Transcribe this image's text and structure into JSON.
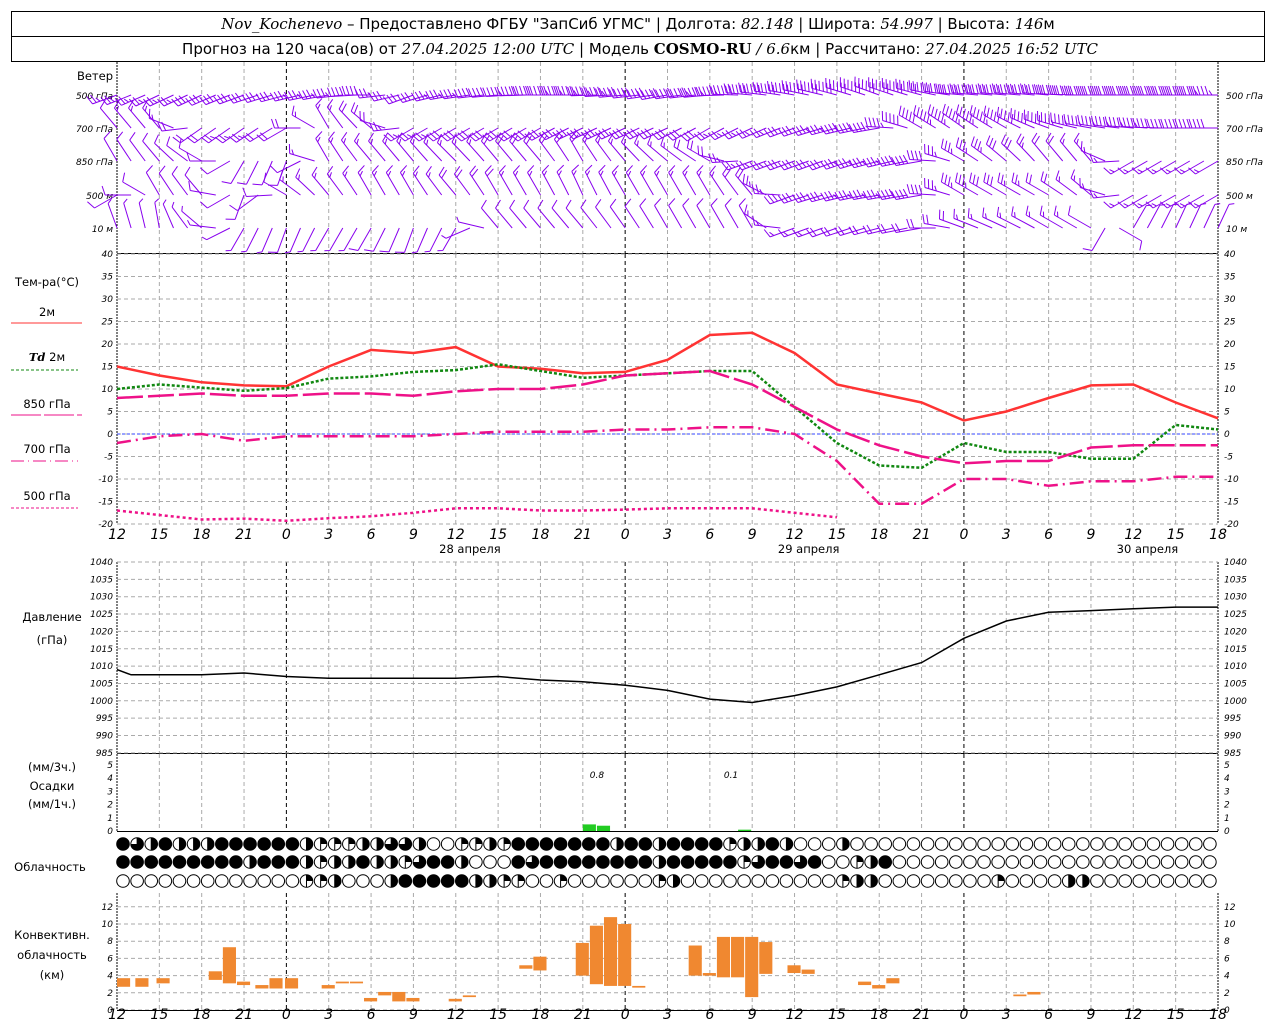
{
  "header": {
    "station": "Nov_Kochenevo",
    "provider": " – Предоставлено ФГБУ \"ЗапСиб УГМС\"",
    "lon_label": "Долгота:",
    "lon": "82.148",
    "lat_label": "Широта:",
    "lat": "54.997",
    "alt_label": "Высота:",
    "alt": "146",
    "alt_unit": "м",
    "forecast_label": "Прогноз на 120 часа(ов) от",
    "forecast_start": "27.04.2025 12:00 UTC",
    "model_label": "Модель",
    "model": "COSMO-RU",
    "resolution": "6.6",
    "resolution_unit": "км",
    "computed_label": "Рассчитано:",
    "computed": "27.04.2025 16:52 UTC"
  },
  "labels": {
    "wind": "Ветер",
    "wind_levels": [
      "500 гПа",
      "700 гПа",
      "850 гПа",
      "500 м",
      "10  м"
    ],
    "temp_title": "Тем-ра(°C)",
    "t2m": "2м",
    "td": "Td",
    "td2m": "2м",
    "t850": "850 гПа",
    "t700": "700 гПа",
    "t500": "500 гПа",
    "pressure": "Давление",
    "pressure_unit": "(гПа)",
    "precip_3h": "(мм/3ч.)",
    "precip": "Осадки",
    "precip_1h": "(мм/1ч.)",
    "cloud": "Облачность",
    "conv1": "Конвективн.",
    "conv2": "облачность",
    "conv3": "(км)"
  },
  "colors": {
    "t2m": "#ff3333",
    "td": "#118811",
    "upper": "#ee1188",
    "wind": "#8800ee",
    "precip": "#22cc22",
    "conv": "#f08830",
    "zero_line": "#3344ff"
  },
  "chart_data": [
    {
      "type": "line",
      "ylabel": "Тем-ра(°C)",
      "ylim": [
        -20,
        40
      ],
      "grid": true,
      "x_hours_from_start": [
        0,
        3,
        6,
        9,
        12,
        15,
        18,
        21,
        24,
        27,
        30,
        33,
        36,
        39,
        42,
        45,
        48,
        51,
        54,
        57,
        60,
        63,
        66,
        69,
        72,
        75,
        78
      ],
      "x_tick_labels": [
        "12",
        "15",
        "18",
        "21",
        "0",
        "3",
        "6",
        "9",
        "12",
        "15",
        "18",
        "21",
        "0",
        "3",
        "6",
        "9",
        "12",
        "15",
        "18",
        "21",
        "0",
        "3",
        "6",
        "9",
        "12",
        "15",
        "18"
      ],
      "day_labels": [
        "28 апреля",
        "29 апреля",
        "30 апреля"
      ],
      "y_ticks": [
        -20,
        -15,
        -10,
        -5,
        0,
        5,
        10,
        15,
        20,
        25,
        30,
        35,
        40
      ],
      "series": [
        {
          "name": "2м",
          "style": "solid",
          "values": [
            15,
            13,
            11.5,
            10.8,
            10.6,
            15,
            18.7,
            18,
            19.3,
            15,
            14.5,
            13.5,
            13.8,
            16.5,
            22,
            22.5,
            18,
            11,
            9,
            7,
            3,
            5,
            8,
            10.8,
            11,
            7,
            3.5
          ]
        },
        {
          "name": "Td 2м",
          "style": "dotted",
          "values": [
            10,
            11,
            10.3,
            9.6,
            10.2,
            12.3,
            12.8,
            13.8,
            14.2,
            15.5,
            14,
            12.5,
            13,
            13.5,
            14,
            14,
            6,
            -2,
            -7,
            -7.5,
            -2,
            -4,
            -4,
            -5.5,
            -5.5,
            2,
            1
          ]
        },
        {
          "name": "850 гПа",
          "style": "dashed",
          "values": [
            8,
            8.5,
            9,
            8.5,
            8.5,
            9,
            9,
            8.5,
            9.5,
            10,
            10,
            11,
            13,
            13.5,
            14,
            11,
            6,
            1,
            -2.5,
            -5,
            -6.5,
            -6,
            -6,
            -3,
            -2.5,
            -2.5,
            -2.5
          ]
        },
        {
          "name": "700 гПа",
          "style": "dashdot",
          "values": [
            -2,
            -0.5,
            0,
            -1.5,
            -0.5,
            -0.5,
            -0.5,
            -0.5,
            0,
            0.5,
            0.5,
            0.5,
            1,
            1,
            1.5,
            1.5,
            0,
            -6,
            -15.5,
            -15.5,
            -10,
            -10,
            -11.5,
            -10.5,
            -10.5,
            -9.5,
            -9.5
          ]
        },
        {
          "name": "500 гПа",
          "style": "dotted2",
          "values": [
            -17,
            -18,
            -19,
            -18.8,
            -19.3,
            -18.7,
            -18.3,
            -17.5,
            -16.5,
            -16.5,
            -17,
            -17,
            -16.8,
            -16.5,
            -16.5,
            -16.5,
            -17.5,
            -18.5,
            null,
            null,
            null,
            null,
            null,
            null,
            null,
            null,
            null
          ]
        }
      ]
    },
    {
      "type": "line",
      "ylabel": "Давление (гПа)",
      "ylim": [
        985,
        1040
      ],
      "grid": true,
      "y_ticks": [
        985,
        990,
        995,
        1000,
        1005,
        1010,
        1015,
        1020,
        1025,
        1030,
        1035,
        1040
      ],
      "x_hours_from_start": [
        0,
        1,
        3,
        6,
        9,
        12,
        15,
        18,
        21,
        24,
        27,
        30,
        33,
        36,
        39,
        42,
        45,
        48,
        51,
        54,
        57,
        60,
        63,
        66,
        69,
        72,
        75,
        78
      ],
      "values": [
        1009,
        1007.5,
        1007.5,
        1007.5,
        1008,
        1007,
        1006.5,
        1006.5,
        1006.5,
        1006.5,
        1007,
        1006,
        1005.5,
        1004.5,
        1003,
        1000.5,
        999.5,
        1001.5,
        1004,
        1007.5,
        1011,
        1018,
        1023,
        1025.5,
        1026,
        1026.5,
        1027,
        1027
      ]
    },
    {
      "type": "bar",
      "ylabel": "Осадки",
      "ylim": [
        0,
        5
      ],
      "y_ticks": [
        0,
        1,
        2,
        3,
        4,
        5
      ],
      "bars": [
        {
          "hour": 33.5,
          "value": 0.5
        },
        {
          "hour": 34.5,
          "value": 0.4
        },
        {
          "hour": 44.5,
          "value": 0.1
        }
      ],
      "annotations": [
        {
          "hour": 34,
          "text": "0.8"
        },
        {
          "hour": 43.5,
          "text": "0.1"
        }
      ]
    },
    {
      "type": "table",
      "ylabel": "Облачность",
      "rows_octants_quarters": [
        "432422244444421112233200112144444442442444412242000200000000000000000000000000",
        "444444444244421224221344200043444444442444441344340012400000000000000000000000",
        "000000000000011200024444422110010000001200000000000122000000001000022000000000"
      ]
    },
    {
      "type": "bar",
      "ylabel": "Конвективн. облачность (км)",
      "ylim": [
        0,
        13
      ],
      "y_ticks": [
        0,
        2,
        4,
        6,
        8,
        10,
        12
      ],
      "bars": [
        {
          "hour": 0.5,
          "base": 2.7,
          "top": 3.7
        },
        {
          "hour": 1.8,
          "base": 2.7,
          "top": 3.7
        },
        {
          "hour": 3.3,
          "base": 3.1,
          "top": 3.7
        },
        {
          "hour": 7,
          "base": 3.5,
          "top": 4.5
        },
        {
          "hour": 8,
          "base": 3.1,
          "top": 7.3
        },
        {
          "hour": 9,
          "base": 2.9,
          "top": 3.3
        },
        {
          "hour": 10.3,
          "base": 2.5,
          "top": 2.9
        },
        {
          "hour": 11.3,
          "base": 2.5,
          "top": 3.7
        },
        {
          "hour": 12.4,
          "base": 2.5,
          "top": 3.7
        },
        {
          "hour": 15,
          "base": 2.5,
          "top": 2.9
        },
        {
          "hour": 16,
          "base": 3.1,
          "top": 3.3
        },
        {
          "hour": 17,
          "base": 3.1,
          "top": 3.3
        },
        {
          "hour": 18,
          "base": 1.0,
          "top": 1.4
        },
        {
          "hour": 19,
          "base": 1.7,
          "top": 2.1
        },
        {
          "hour": 20,
          "base": 1.0,
          "top": 2.1
        },
        {
          "hour": 21,
          "base": 1.0,
          "top": 1.4
        },
        {
          "hour": 24,
          "base": 1.0,
          "top": 1.3
        },
        {
          "hour": 25,
          "base": 1.5,
          "top": 1.7
        },
        {
          "hour": 29,
          "base": 4.8,
          "top": 5.2
        },
        {
          "hour": 30,
          "base": 4.6,
          "top": 6.2
        },
        {
          "hour": 33,
          "base": 4.0,
          "top": 7.8
        },
        {
          "hour": 34,
          "base": 3.0,
          "top": 9.8
        },
        {
          "hour": 35,
          "base": 2.8,
          "top": 10.8
        },
        {
          "hour": 36,
          "base": 2.8,
          "top": 10.0
        },
        {
          "hour": 37,
          "base": 2.6,
          "top": 2.8
        },
        {
          "hour": 41,
          "base": 4.0,
          "top": 7.5
        },
        {
          "hour": 42,
          "base": 4.0,
          "top": 4.3
        },
        {
          "hour": 43,
          "base": 3.8,
          "top": 8.5
        },
        {
          "hour": 44,
          "base": 3.8,
          "top": 8.5
        },
        {
          "hour": 45,
          "base": 1.5,
          "top": 8.5
        },
        {
          "hour": 46,
          "base": 4.2,
          "top": 7.9
        },
        {
          "hour": 48,
          "base": 4.3,
          "top": 5.2
        },
        {
          "hour": 49,
          "base": 4.2,
          "top": 4.7
        },
        {
          "hour": 53,
          "base": 2.9,
          "top": 3.3
        },
        {
          "hour": 54,
          "base": 2.5,
          "top": 2.9
        },
        {
          "hour": 55,
          "base": 3.1,
          "top": 3.7
        },
        {
          "hour": 64,
          "base": 1.6,
          "top": 1.8
        },
        {
          "hour": 65,
          "base": 1.8,
          "top": 2.1
        }
      ]
    },
    {
      "type": "wind-barbs",
      "ylabel": "Ветер",
      "units": "м/с",
      "x_hours_from_start": [
        0,
        3,
        6,
        9,
        12,
        15,
        18,
        21,
        24,
        27,
        30,
        33,
        36,
        39,
        42,
        45,
        48,
        51,
        54,
        57,
        60,
        63,
        66,
        69,
        72,
        75,
        78
      ],
      "levels": [
        {
          "name": "500 гПа",
          "dir": [
            250,
            245,
            245,
            250,
            255,
            260,
            270,
            250,
            260,
            265,
            270,
            270,
            265,
            260,
            265,
            275,
            280,
            285,
            290,
            285,
            275,
            275,
            275,
            270,
            270,
            270,
            270
          ],
          "speed": [
            12,
            12,
            14,
            15,
            16,
            18,
            20,
            14,
            18,
            20,
            26,
            28,
            26,
            25,
            28,
            30,
            32,
            34,
            36,
            40,
            42,
            40,
            38,
            35,
            32,
            30,
            28
          ]
        },
        {
          "name": "700 гПа",
          "dir": [
            320,
            320,
            235,
            235,
            240,
            330,
            310,
            240,
            240,
            240,
            240,
            245,
            245,
            245,
            240,
            245,
            250,
            255,
            260,
            300,
            305,
            300,
            290,
            280,
            275,
            270,
            270
          ],
          "speed": [
            6,
            8,
            10,
            12,
            10,
            8,
            10,
            12,
            14,
            14,
            14,
            14,
            15,
            14,
            14,
            13,
            14,
            18,
            22,
            26,
            28,
            26,
            24,
            22,
            22,
            20,
            20
          ]
        },
        {
          "name": "850 гПа",
          "dir": [
            330,
            320,
            300,
            210,
            200,
            330,
            320,
            320,
            315,
            320,
            320,
            330,
            320,
            310,
            300,
            250,
            250,
            250,
            255,
            260,
            300,
            310,
            320,
            320,
            240,
            240,
            240
          ],
          "speed": [
            5,
            6,
            6,
            4,
            4,
            8,
            8,
            8,
            8,
            9,
            9,
            9,
            8,
            8,
            10,
            12,
            14,
            16,
            18,
            20,
            18,
            16,
            10,
            8,
            8,
            8,
            8
          ]
        },
        {
          "name": "500 м",
          "dir": [
            240,
            330,
            320,
            200,
            300,
            320,
            330,
            330,
            320,
            330,
            330,
            335,
            330,
            330,
            330,
            320,
            250,
            255,
            260,
            260,
            300,
            300,
            300,
            310,
            240,
            240,
            240
          ],
          "speed": [
            6,
            6,
            5,
            5,
            6,
            8,
            8,
            8,
            9,
            9,
            8,
            8,
            7,
            7,
            8,
            10,
            14,
            16,
            18,
            20,
            18,
            14,
            10,
            8,
            8,
            8,
            8
          ]
        },
        {
          "name": "10 м",
          "dir": [
            340,
            350,
            310,
            210,
            200,
            210,
            210,
            200,
            210,
            320,
            320,
            320,
            325,
            330,
            330,
            330,
            250,
            250,
            255,
            260,
            290,
            295,
            300,
            300,
            30,
            25,
            25
          ],
          "speed": [
            3,
            3,
            3,
            3,
            4,
            3,
            4,
            4,
            3,
            4,
            5,
            5,
            5,
            5,
            6,
            6,
            8,
            9,
            10,
            10,
            9,
            8,
            7,
            6,
            3,
            3,
            3
          ]
        }
      ]
    }
  ]
}
